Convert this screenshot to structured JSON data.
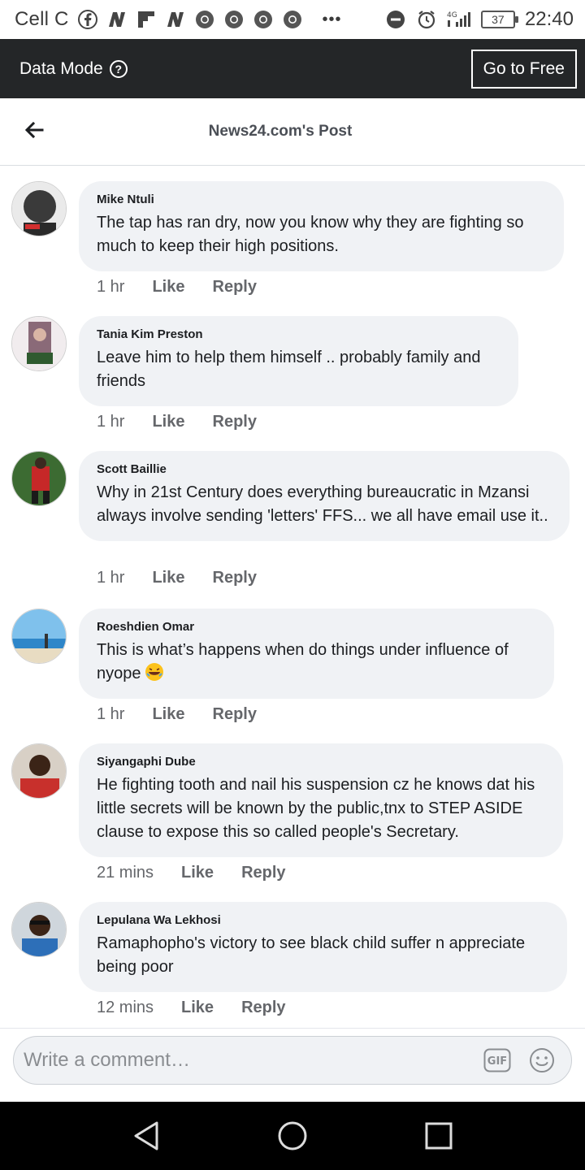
{
  "status_bar": {
    "carrier": "Cell C",
    "battery": "37",
    "network": "4G",
    "time": "22:40",
    "notification_icons": [
      "facebook-icon",
      "n-icon",
      "flipboard-icon",
      "n-icon",
      "chrome-icon",
      "chrome-icon",
      "chrome-icon",
      "chrome-icon"
    ],
    "more": "•••"
  },
  "data_bar": {
    "label": "Data Mode",
    "help": "?",
    "go_free": "Go to Free"
  },
  "header": {
    "title": "News24.com's Post"
  },
  "comments": [
    {
      "author": "Mike Ntuli",
      "text": "The tap has ran dry, now you know why they are fighting so much to keep their high positions.",
      "time": "1 hr",
      "like": "Like",
      "reply": "Reply",
      "avatar_color": "#6b6b6b"
    },
    {
      "author": "Tania Kim Preston",
      "text": "Leave him to help them himself .. probably family and friends",
      "time": "1 hr",
      "like": "Like",
      "reply": "Reply",
      "avatar_color": "#8a6a78"
    },
    {
      "author": "Scott Baillie",
      "text": "Why in 21st Century does everything bureaucratic in Mzansi always involve sending 'letters' FFS... we all have email use it..",
      "time": "1 hr",
      "like": "Like",
      "reply": "Reply",
      "avatar_color": "#3c6b32"
    },
    {
      "author": "Roeshdien Omar",
      "text": "This is what’s happens when do things under influence of nyope",
      "time": "1 hr",
      "like": "Like",
      "reply": "Reply",
      "avatar_color": "#4a9bd6"
    },
    {
      "author": "Siyangaphi Dube",
      "text": "He fighting  tooth and nail his suspension  cz he knows dat his little secrets  will be known by the  public,tnx to STEP ASIDE  clause to expose this so called people's Secretary.",
      "time": "21 mins",
      "like": "Like",
      "reply": "Reply",
      "avatar_color": "#c8302c"
    },
    {
      "author": "Lepulana Wa Lekhosi",
      "text": "Ramaphopho's victory to see black child suffer n appreciate being poor",
      "time": "12 mins",
      "like": "Like",
      "reply": "Reply",
      "avatar_color": "#2d4f7a"
    }
  ],
  "composer": {
    "placeholder": "Write a comment…",
    "gif_label": "GIF"
  },
  "colors": {
    "data_bar_bg": "#242628",
    "bubble_bg": "#f0f2f5",
    "meta_text": "#65676b"
  }
}
